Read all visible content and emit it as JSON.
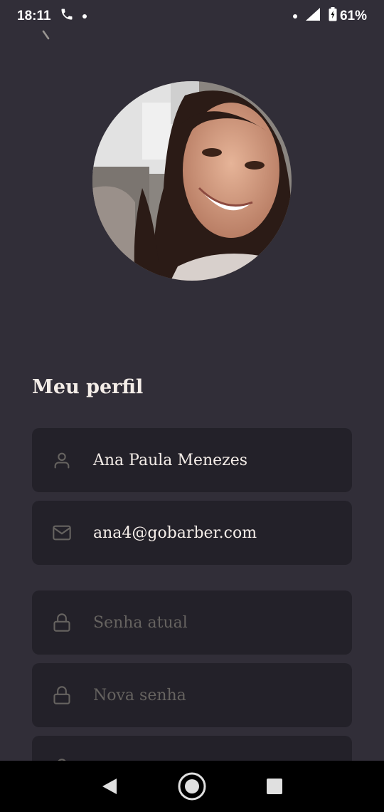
{
  "status_bar": {
    "time": "18:11",
    "battery": "61%"
  },
  "icons": {
    "back": "chevron-left-icon",
    "user": "user-icon",
    "mail": "mail-icon",
    "lock": "lock-icon",
    "phone": "phone-icon",
    "signal": "signal-icon",
    "battery": "battery-icon",
    "nav_back": "triangle-back-icon",
    "nav_home": "circle-home-icon",
    "nav_recents": "square-recents-icon"
  },
  "profile": {
    "title": "Meu perfil",
    "name_value": "Ana Paula Menezes",
    "email_value": "ana4@gobarber.com",
    "current_password_placeholder": "Senha atual",
    "new_password_placeholder": "Nova senha"
  },
  "colors": {
    "background": "#312e38",
    "input_background": "#232129",
    "text": "#f4ede8",
    "placeholder": "#666360",
    "icon": "#666360"
  }
}
